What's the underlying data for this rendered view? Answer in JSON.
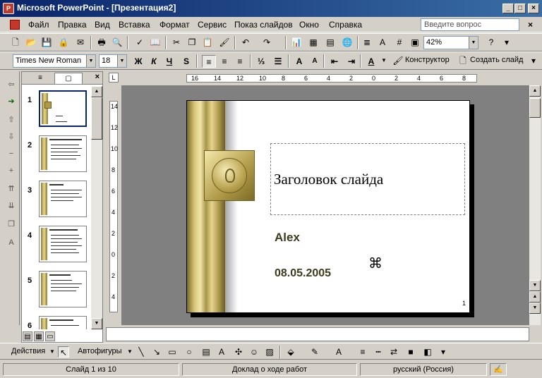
{
  "window": {
    "title": "Microsoft PowerPoint - [Презентация2]",
    "app_icon": "P",
    "minimize": "_",
    "maximize": "□",
    "close": "×"
  },
  "menu": {
    "items": [
      "Файл",
      "Правка",
      "Вид",
      "Вставка",
      "Формат",
      "Сервис",
      "Показ слайдов",
      "Окно",
      "Справка"
    ],
    "help_placeholder": "Введите вопрос",
    "doc_close": "×"
  },
  "toolbar1": {
    "zoom": "42%"
  },
  "toolbar2": {
    "font": "Times New Roman",
    "size": "18",
    "bold": "Ж",
    "italic": "К",
    "underline": "Ч",
    "shadow": "S",
    "design_label": "Конструктор",
    "new_slide_label": "Создать слайд"
  },
  "left_panel": {
    "tab_outline": "≡",
    "tab_slides": "▢",
    "close": "×",
    "slides": [
      {
        "num": "1"
      },
      {
        "num": "2"
      },
      {
        "num": "3"
      },
      {
        "num": "4"
      },
      {
        "num": "5"
      },
      {
        "num": "6"
      }
    ]
  },
  "ruler_h": [
    "16",
    "14",
    "12",
    "10",
    "8",
    "6",
    "4",
    "2",
    "0",
    "2",
    "4",
    "6",
    "8"
  ],
  "ruler_v": [
    "14",
    "12",
    "10",
    "8",
    "6",
    "4",
    "2",
    "0",
    "2",
    "4"
  ],
  "slide": {
    "title": "Заголовок слайда",
    "author": "Alex",
    "date": "08.05.2005",
    "page_number": "1"
  },
  "drawbar": {
    "actions_label": "Действия",
    "autoshapes_label": "Автофигуры"
  },
  "status": {
    "slide_info": "Слайд 1 из 10",
    "design": "Доклад о ходе работ",
    "language": "русский (Россия)"
  },
  "colors": {
    "titlebar": "#0a246a",
    "slide_text": "#3d3b1e",
    "gold": "#d8c77a"
  }
}
